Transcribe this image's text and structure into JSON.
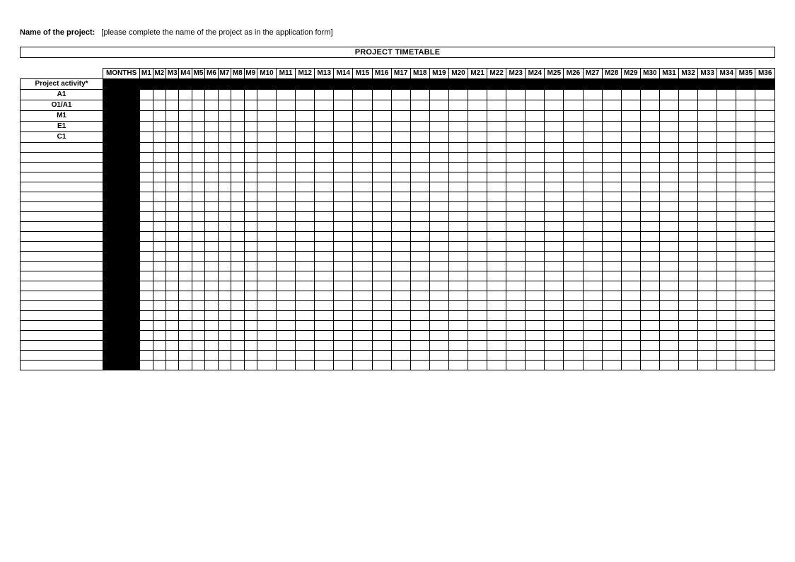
{
  "name_label": "Name of the project:",
  "name_placeholder": "[please complete the name of the project as in the application form]",
  "title": "PROJECT TIMETABLE",
  "header": {
    "activity": "Project activity*",
    "months": "MONTHS",
    "month_cols": [
      "M1",
      "M2",
      "M3",
      "M4",
      "M5",
      "M6",
      "M7",
      "M8",
      "M9",
      "M10",
      "M11",
      "M12",
      "M13",
      "M14",
      "M15",
      "M16",
      "M17",
      "M18",
      "M19",
      "M20",
      "M21",
      "M22",
      "M23",
      "M24",
      "M25",
      "M26",
      "M27",
      "M28",
      "M29",
      "M30",
      "M31",
      "M32",
      "M33",
      "M34",
      "M35",
      "M36"
    ]
  },
  "rows": [
    {
      "activity": "A1",
      "black_row": true
    },
    {
      "activity": "O1/A1",
      "black_row": false
    },
    {
      "activity": "M1",
      "black_row": false
    },
    {
      "activity": "E1",
      "black_row": false
    },
    {
      "activity": "C1",
      "black_row": false
    },
    {
      "activity": "",
      "black_row": false
    },
    {
      "activity": "",
      "black_row": false
    },
    {
      "activity": "",
      "black_row": false
    },
    {
      "activity": "",
      "black_row": false
    },
    {
      "activity": "",
      "black_row": false
    },
    {
      "activity": "",
      "black_row": false
    },
    {
      "activity": "",
      "black_row": false
    },
    {
      "activity": "",
      "black_row": false
    },
    {
      "activity": "",
      "black_row": false
    },
    {
      "activity": "",
      "black_row": false
    },
    {
      "activity": "",
      "black_row": false
    },
    {
      "activity": "",
      "black_row": false
    },
    {
      "activity": "",
      "black_row": false
    },
    {
      "activity": "",
      "black_row": false
    },
    {
      "activity": "",
      "black_row": false
    },
    {
      "activity": "",
      "black_row": false
    },
    {
      "activity": "",
      "black_row": false
    },
    {
      "activity": "",
      "black_row": false
    },
    {
      "activity": "",
      "black_row": false
    },
    {
      "activity": "",
      "black_row": false
    },
    {
      "activity": "",
      "black_row": false
    },
    {
      "activity": "",
      "black_row": false
    },
    {
      "activity": "",
      "black_row": false
    }
  ]
}
